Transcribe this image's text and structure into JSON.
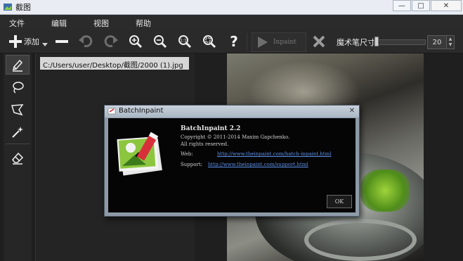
{
  "window": {
    "title": "截图",
    "minimize_glyph": "—",
    "maximize_glyph": "□",
    "close_glyph": "✕"
  },
  "menu": {
    "items": [
      {
        "label": "文件"
      },
      {
        "label": "编辑"
      },
      {
        "label": "视图"
      },
      {
        "label": "帮助"
      }
    ]
  },
  "toolbar": {
    "add_label": "添加",
    "inpaint_label": "Inpaint",
    "brush_size_label": "魔术笔尺寸",
    "brush_size_value": "20",
    "brush_size_fraction": 0.02,
    "icons": [
      "plus-icon",
      "dropdown-arrow-icon",
      "minus-icon",
      "undo-icon",
      "redo-icon",
      "zoom-in-icon",
      "zoom-out-icon",
      "actual-size-icon",
      "fit-icon",
      "help-icon",
      "play-icon",
      "clear-icon"
    ]
  },
  "tools": {
    "icons": [
      "marker-icon",
      "lasso-icon",
      "polygon-lasso-icon",
      "magic-wand-icon",
      "eraser-icon"
    ],
    "active": "marker-icon"
  },
  "files": {
    "items": [
      {
        "path": "C:/Users/user/Desktop/截图/2000 (1).jpg"
      }
    ]
  },
  "dialog": {
    "title": "BatchInpaint",
    "close_glyph": "✕",
    "name": "BatchInpaint 2.2",
    "copyright": "Copyright © 2011-2014 Maxim Gapchenko.",
    "rights": "All rights reserved.",
    "web_label": "Web:",
    "web_url": "http://www.theinpaint.com/batch-inpaint.html",
    "support_label": "Support:",
    "support_url": "http://www.theinpaint.com/support.html",
    "ok_label": "OK"
  },
  "colors": {
    "background": "#1e1e1e",
    "panel": "#242424",
    "selection": "#d6d6d6",
    "link": "#5b8ee6"
  }
}
